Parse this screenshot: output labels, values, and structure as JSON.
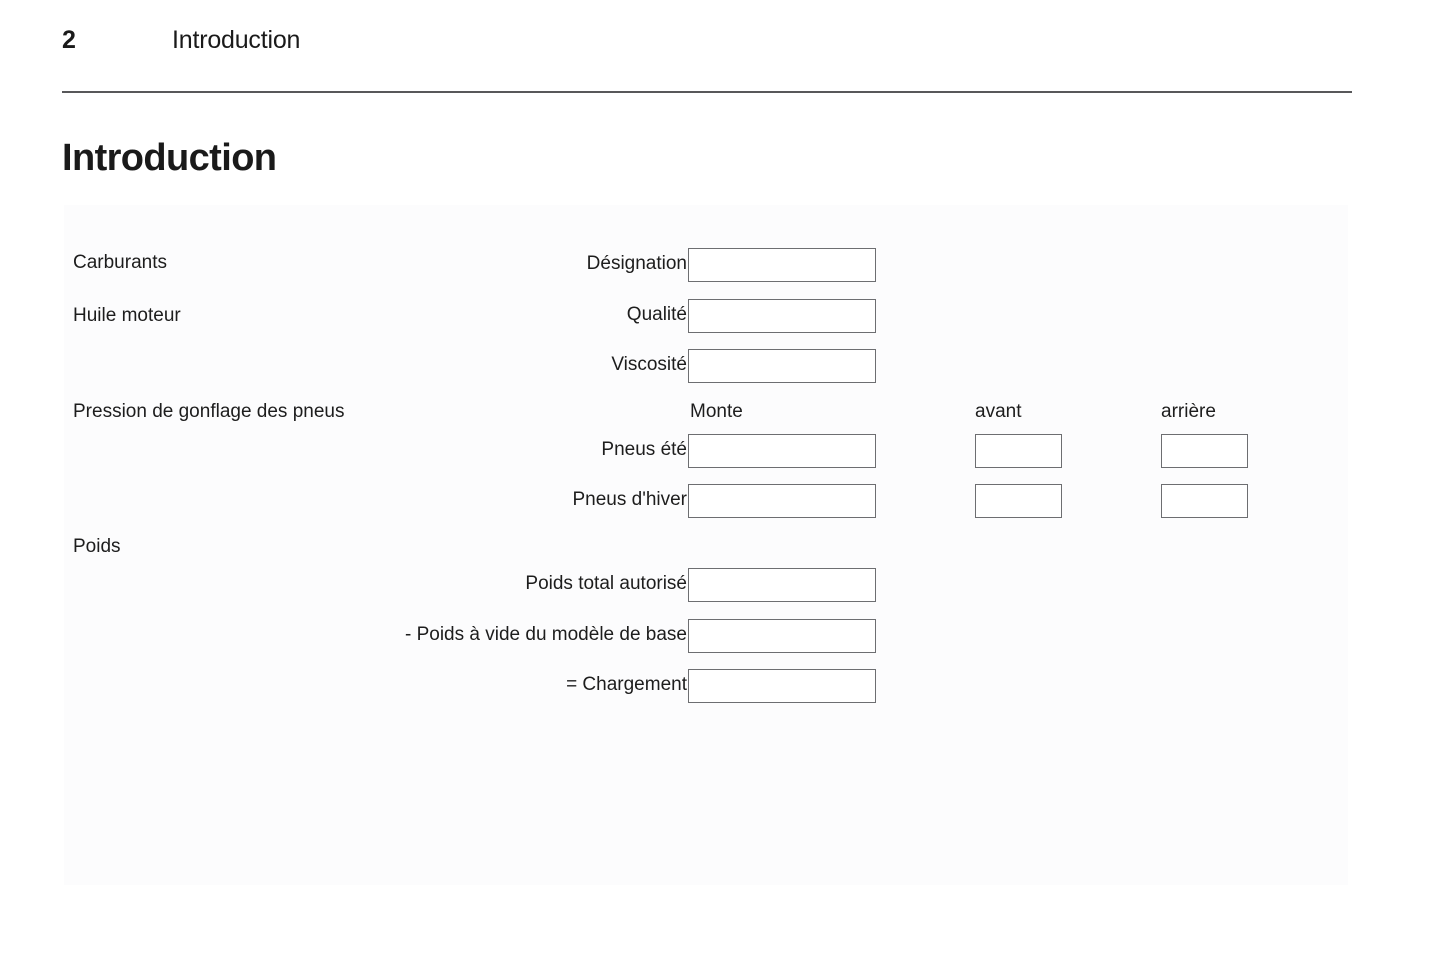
{
  "header": {
    "page_number": "2",
    "chapter": "Introduction"
  },
  "title": "Introduction",
  "form": {
    "sections": [
      {
        "label": "Carburants"
      },
      {
        "label": "Huile moteur"
      },
      {
        "label": "Pression de gonflage des pneus"
      },
      {
        "label": "Poids"
      }
    ],
    "column_headers": {
      "monte": "Monte",
      "front": "avant",
      "rear": "arrière"
    },
    "rows": [
      {
        "label": "Désignation",
        "value": "",
        "placeholder": ""
      },
      {
        "label": "Qualité",
        "value": "",
        "placeholder": ""
      },
      {
        "label": "Viscosité",
        "value": "",
        "placeholder": ""
      },
      {
        "label": "Pneus été",
        "value": "",
        "placeholder": "",
        "front_value": "",
        "rear_value": ""
      },
      {
        "label": "Pneus d'hiver",
        "value": "",
        "placeholder": "",
        "front_value": "",
        "rear_value": ""
      },
      {
        "label": "Poids total autorisé",
        "value": "",
        "placeholder": ""
      },
      {
        "label": "- Poids à vide du modèle de base",
        "value": "",
        "placeholder": ""
      },
      {
        "label": "= Chargement",
        "value": "",
        "placeholder": ""
      }
    ]
  }
}
